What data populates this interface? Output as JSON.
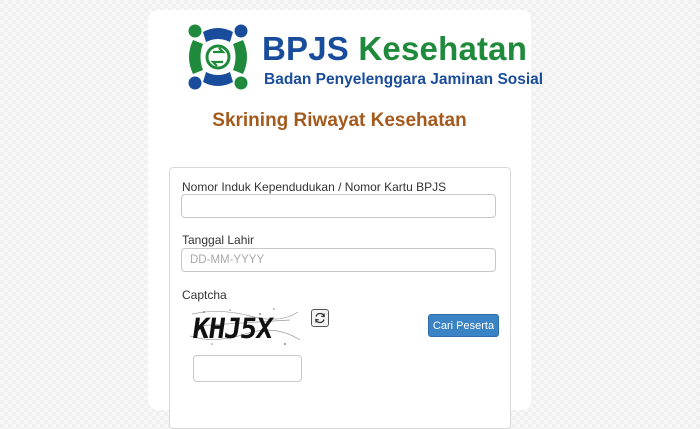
{
  "brand": {
    "name_part1": "BPJS",
    "name_part2": "Kesehatan",
    "tagline": "Badan Penyelenggara Jaminan Sosial"
  },
  "page": {
    "title": "Skrining Riwayat Kesehatan"
  },
  "form": {
    "id_label": "Nomor Induk Kependudukan / Nomor Kartu BPJS",
    "id_value": "",
    "dob_label": "Tanggal Lahir",
    "dob_placeholder": "DD-MM-YYYY",
    "captcha_label": "Captcha",
    "captcha_text": "KHJ5X",
    "captcha_input_value": "",
    "submit_label": "Cari Peserta"
  },
  "icons": {
    "logo": "bpjs-logo-icon",
    "refresh": "refresh-icon"
  },
  "colors": {
    "brand_blue": "#1a4c9c",
    "brand_green": "#1f8a3c",
    "title_brown": "#a45a1c",
    "button_blue": "#3a83c4"
  }
}
